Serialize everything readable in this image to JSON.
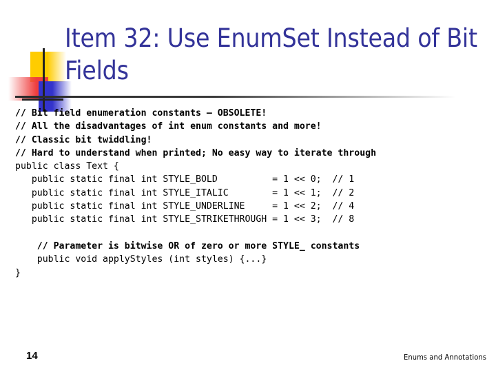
{
  "slide": {
    "title": "Item 32: Use EnumSet Instead of Bit Fields",
    "accent_color": "#333399",
    "background_color": "#ffffff",
    "divider_color": "#2b2b2b"
  },
  "logo": {
    "name": "powerpoint-design-mark",
    "yellow": "#ffcc00",
    "red": "#ef3e3e",
    "blue": "#3333cc",
    "line": "#222222"
  },
  "code": {
    "lines": [
      {
        "text": "// Bit field enumeration constants – OBSOLETE!",
        "style": "comment"
      },
      {
        "text": "// All the disadvantages of int enum constants and more!",
        "style": "comment"
      },
      {
        "text": "// Classic bit twiddling!",
        "style": "comment"
      },
      {
        "text": "// Hard to understand when printed; No easy way to iterate through",
        "style": "comment"
      },
      {
        "text": "public class Text {",
        "style": "code"
      },
      {
        "text": "   public static final int STYLE_BOLD          = 1 << 0;  // 1",
        "style": "code"
      },
      {
        "text": "   public static final int STYLE_ITALIC        = 1 << 1;  // 2",
        "style": "code"
      },
      {
        "text": "   public static final int STYLE_UNDERLINE     = 1 << 2;  // 4",
        "style": "code"
      },
      {
        "text": "   public static final int STYLE_STRIKETHROUGH = 1 << 3;  // 8",
        "style": "code"
      },
      {
        "text": "",
        "style": "blank"
      },
      {
        "text": "    // Parameter is bitwise OR of zero or more STYLE_ constants",
        "style": "comment"
      },
      {
        "text": "    public void applyStyles (int styles) {...}",
        "style": "code"
      },
      {
        "text": "}",
        "style": "code"
      }
    ]
  },
  "footer": {
    "page_number": "14",
    "note": "Enums and Annotations"
  }
}
